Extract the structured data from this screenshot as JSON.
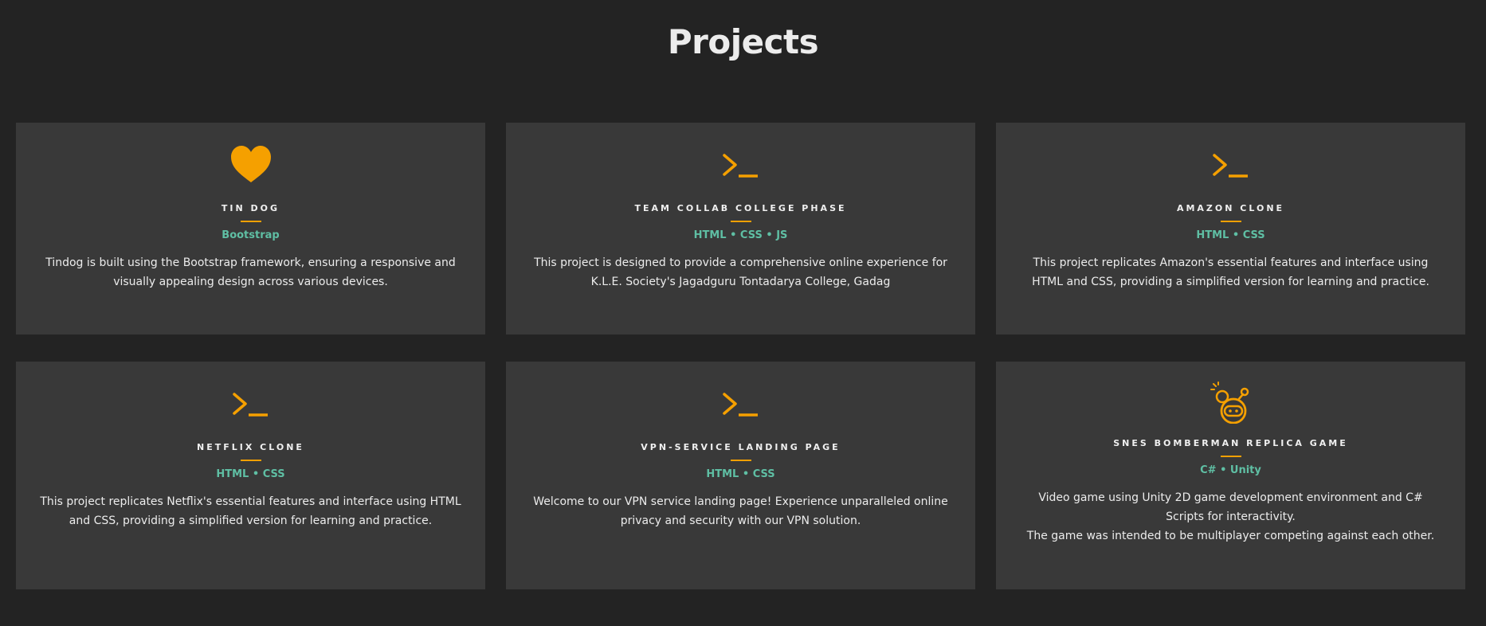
{
  "section": {
    "title": "Projects"
  },
  "colors": {
    "background": "#232323",
    "card": "#393939",
    "accent": "#f5a000",
    "tech": "#5fbfa4"
  },
  "projects": [
    {
      "icon": "heart-icon",
      "title": "Tin Dog",
      "tech": "Bootstrap",
      "description": "Tindog is built using the Bootstrap framework, ensuring a responsive and visually appealing design across various devices."
    },
    {
      "icon": "terminal-icon",
      "title": "Team Collab College Phase",
      "tech": "HTML • CSS • JS",
      "description": "This project is designed to provide a comprehensive online experience for K.L.E. Society's Jagadguru Tontadarya College, Gadag"
    },
    {
      "icon": "terminal-icon",
      "title": "Amazon Clone",
      "tech": "HTML • CSS",
      "description": "This project replicates Amazon's essential features and interface using HTML and CSS, providing a simplified version for learning and practice."
    },
    {
      "icon": "terminal-icon",
      "title": "Netflix Clone",
      "tech": "HTML • CSS",
      "description": "This project replicates Netflix's essential features and interface using HTML and CSS, providing a simplified version for learning and practice."
    },
    {
      "icon": "terminal-icon",
      "title": "VPN-Service Landing Page",
      "tech": "HTML • CSS",
      "description": "Welcome to our VPN service landing page! Experience unparalleled online privacy and security with our VPN solution."
    },
    {
      "icon": "bomberman-icon",
      "title": "SNES Bomberman Replica Game",
      "tech": "C# • Unity",
      "description": "Video game using Unity 2D game development environment and C# Scripts for interactivity.",
      "description_2": "The game was intended to be multiplayer competing against each other."
    }
  ]
}
